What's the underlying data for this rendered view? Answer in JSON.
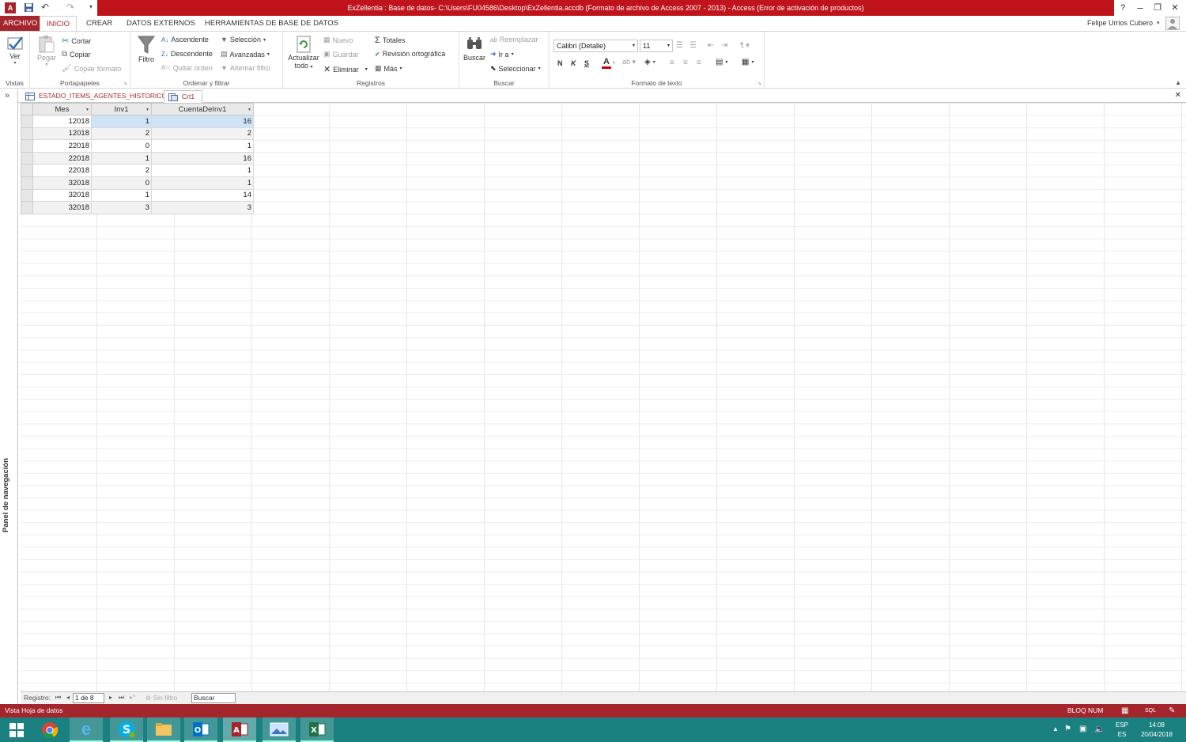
{
  "window": {
    "title": "ExZellentia : Base de datos- C:\\Users\\FU04586\\Desktop\\ExZellentia.accdb (Formato de archivo de Access 2007 - 2013) -  Access (Error de activación de productos)",
    "help": "?",
    "user": "Felipe Urrios Cubero"
  },
  "tabs": [
    "ARCHIVO",
    "INICIO",
    "CREAR",
    "DATOS EXTERNOS",
    "HERRAMIENTAS DE BASE DE DATOS"
  ],
  "ribbon": {
    "vistas": {
      "ver": "Ver",
      "label": "Vistas"
    },
    "portapapeles": {
      "pegar": "Pegar",
      "cortar": "Cortar",
      "copiar": "Copiar",
      "copiar_formato": "Copiar formato",
      "label": "Portapapeles"
    },
    "ordenar": {
      "filtro": "Filtro",
      "ascendente": "Ascendente",
      "descendente": "Descendente",
      "quitar_orden": "Quitar orden",
      "seleccion": "Selección",
      "avanzadas": "Avanzadas",
      "alternar_filtro": "Alternar filtro",
      "label": "Ordenar y filtrar"
    },
    "registros": {
      "actualizar": "Actualizar",
      "todo": "todo",
      "nuevo": "Nuevo",
      "guardar": "Guardar",
      "eliminar": "Eliminar",
      "totales": "Totales",
      "revision": "Revisión ortográfica",
      "mas": "Más",
      "label": "Registros"
    },
    "buscar": {
      "buscar": "Buscar",
      "reemplazar": "Reemplazar",
      "ir_a": "Ir a",
      "seleccionar": "Seleccionar",
      "label": "Buscar"
    },
    "formato": {
      "font": "Calibri (Detalle)",
      "size": "11",
      "bold": "N",
      "italic": "K",
      "underline": "S",
      "label": "Formato de texto"
    }
  },
  "doc_tabs": [
    "ESTADO_ITEMS_AGENTES_HISTORICO",
    "Crt1"
  ],
  "nav_pane": {
    "label": "Panel de navegación",
    "toggle": "»"
  },
  "datasheet": {
    "columns": [
      "Mes",
      "Inv1",
      "CuentaDeInv1"
    ],
    "rows": [
      [
        "12018",
        "1",
        "16"
      ],
      [
        "12018",
        "2",
        "2"
      ],
      [
        "22018",
        "0",
        "1"
      ],
      [
        "22018",
        "1",
        "16"
      ],
      [
        "22018",
        "2",
        "1"
      ],
      [
        "32018",
        "0",
        "1"
      ],
      [
        "32018",
        "1",
        "14"
      ],
      [
        "32018",
        "3",
        "3"
      ]
    ]
  },
  "record_nav": {
    "label": "Registro:",
    "position": "1 de 8",
    "filter": "Sin filtro",
    "search": "Buscar"
  },
  "status": {
    "left": "Vista Hoja de datos",
    "right": "BLOQ NUM"
  },
  "taskbar": {
    "lang": "ESP",
    "kb": "ES",
    "time": "14:08",
    "date": "20/04/2018"
  },
  "colors": {
    "accent": "#a4262c",
    "title_red": "#c0141d",
    "taskbar": "#1b8080"
  }
}
